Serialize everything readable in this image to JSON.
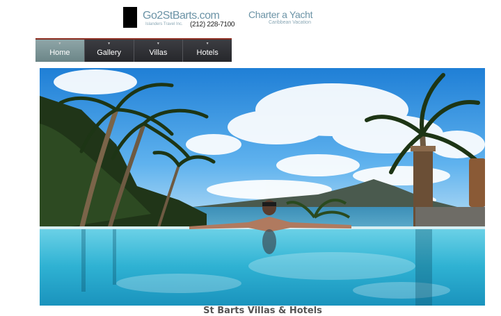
{
  "header": {
    "logo_title": "Go2StBarts.com",
    "logo_subtitle": "Islanders Travel Inc.",
    "phone": "(212) 228-7100",
    "charter_link": "Charter a Yacht",
    "charter_subtitle": "Caribbean Vacation"
  },
  "nav": {
    "items": [
      {
        "label": "Home"
      },
      {
        "label": "Gallery"
      },
      {
        "label": "Villas"
      },
      {
        "label": "Hotels"
      }
    ],
    "active": "Home"
  },
  "hero": {
    "image": "infinity-pool-ocean-view-photo"
  },
  "caption": "St Barts Villas & Hotels",
  "colors": {
    "nav_active": "#7a9597",
    "nav_bg": "#2b2c30",
    "nav_accent": "#8a2b1f",
    "brand_text": "#6b93a6"
  }
}
